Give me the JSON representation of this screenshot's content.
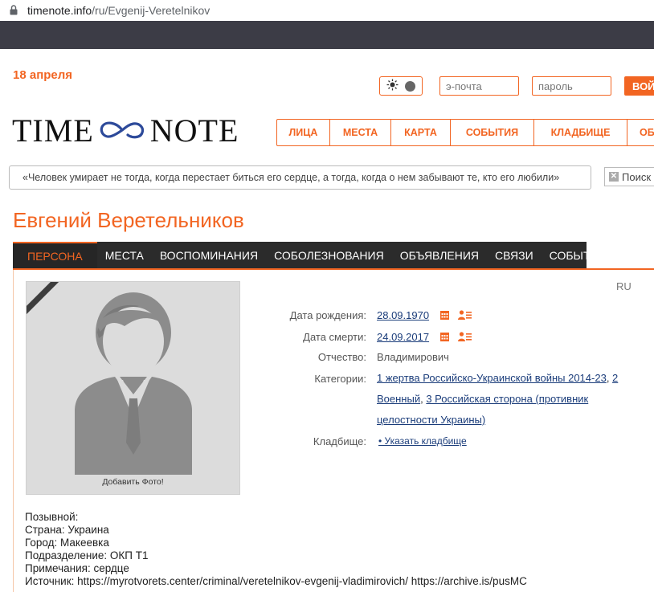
{
  "browser": {
    "url_domain": "timenote.info",
    "url_path": "/ru/Evgenij-Veretelnikov"
  },
  "header": {
    "date": "18 апреля",
    "email_placeholder": "э-почта",
    "password_placeholder": "пароль",
    "login_label": "ВОЙ",
    "logo_left": "TIME",
    "logo_right": "NOTE",
    "brand_color": "#f26522"
  },
  "nav": {
    "items": [
      "ЛИЦА",
      "МЕСТА",
      "КАРТА",
      "СОБЫТИЯ",
      "КЛАДБИЩЕ",
      "ОБ"
    ]
  },
  "quote": "«Человек умирает не тогда, когда перестает биться его сердце, а тогда, когда о нем забывают те, кто его любили»",
  "search": {
    "placeholder": "Поиск"
  },
  "person": {
    "name": "Евгений Веретельников",
    "tabs": [
      "ПЕРСОНА",
      "МЕСТА",
      "ВОСПОМИНАНИЯ",
      "СОБОЛЕЗНОВАНИЯ",
      "ОБЪЯВЛЕНИЯ",
      "СВЯЗИ",
      "СОБЫТИЯ"
    ],
    "language": "RU",
    "add_photo": "Добавить Фото!",
    "fields": {
      "birth_label": "Дата рождения:",
      "birth_value": "28.09.1970",
      "death_label": "Дата смерти:",
      "death_value": "24.09.2017",
      "patronymic_label": "Отчество:",
      "patronymic_value": "Владимирович",
      "categories_label": "Категории:",
      "category_1": "1 жертва Российско-Украинской войны 2014-23",
      "category_2": "2 Военный",
      "category_3": "3 Российская сторона (противник целостности Украины)",
      "cemetery_label": "Кладбище:",
      "cemetery_value": "• Указать кладбище"
    },
    "bio": [
      "Позывной:",
      "Страна: Украина",
      "Город: Макеевка",
      "Подразделение: ОКП Т1",
      "Примечания: сердце",
      "Источник: https://myrotvorets.center/criminal/veretelnikov-evgenij-vladimirovich/ https://archive.is/pusMC"
    ]
  }
}
